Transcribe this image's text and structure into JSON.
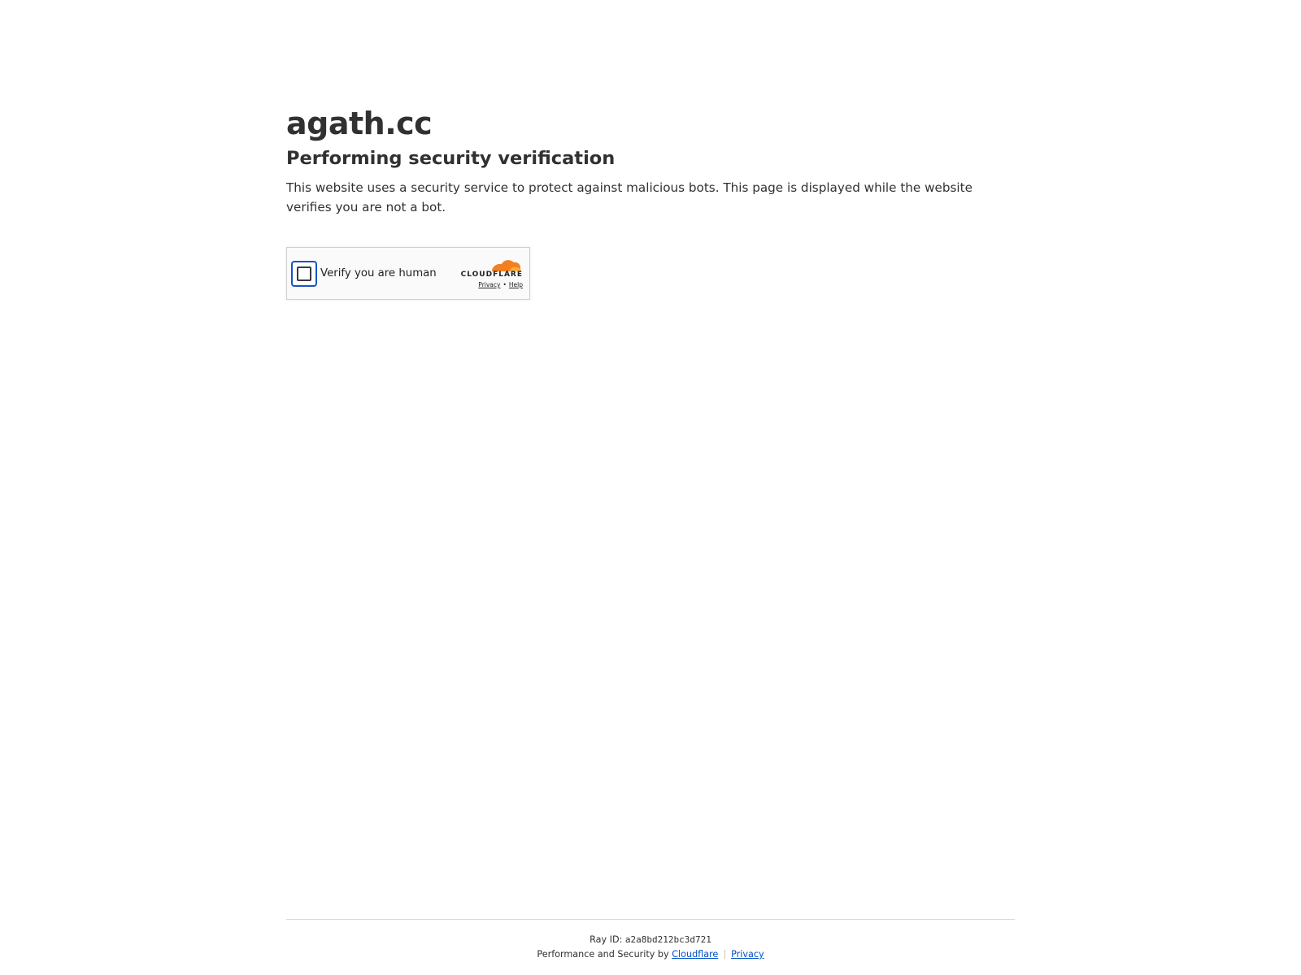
{
  "page": {
    "site_name": "agath.cc",
    "heading": "Performing security verification",
    "description": "This website uses a security service to protect against malicious bots. This page is displayed while the website verifies you are not a bot."
  },
  "widget": {
    "label": "Verify you are human",
    "brand": "CLOUDFLARE",
    "privacy_link": "Privacy",
    "separator": "•",
    "help_link": "Help",
    "icon": "cloudflare-cloud-icon",
    "brand_color": "#f38020",
    "checkbox_focus_color": "#1a54c2"
  },
  "footer": {
    "ray_label": "Ray ID:",
    "ray_id": "a2a8bd212bc3d721",
    "performance_text": "Performance and Security by",
    "cloudflare_link": "Cloudflare",
    "separator": "|",
    "privacy_link": "Privacy",
    "link_color": "#0051c3"
  }
}
